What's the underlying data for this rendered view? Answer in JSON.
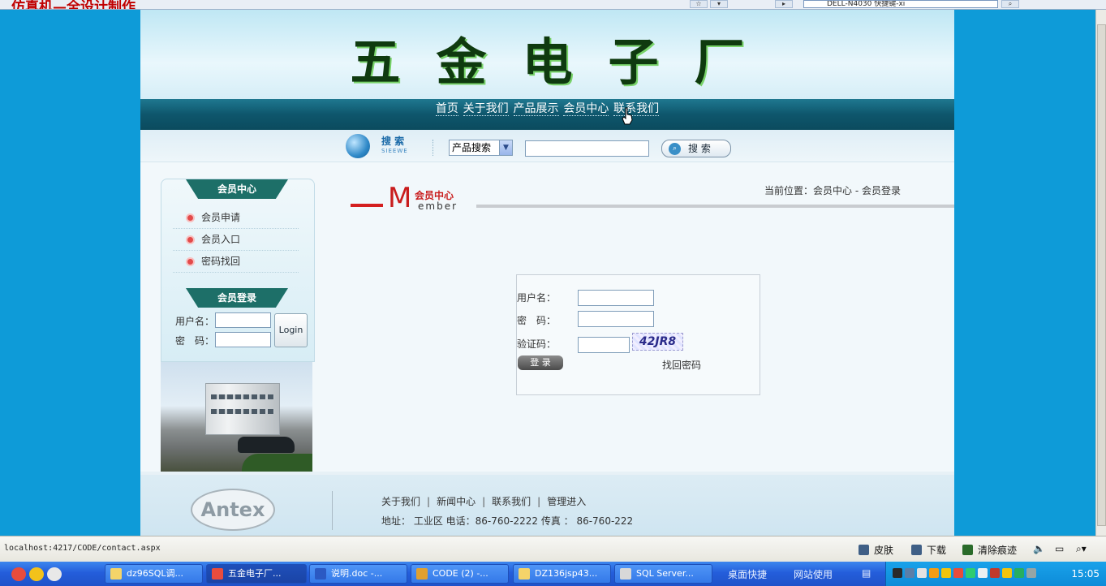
{
  "browser": {
    "ghost_title": "仿真机—全设计制作",
    "address_snippet": "DELL-N4030 快捷键-xi"
  },
  "site": {
    "title": "五金电子厂",
    "nav": [
      "首页",
      "关于我们",
      "产品展示",
      "会员中心",
      "联系我们"
    ],
    "search": {
      "label_cn": "搜 索",
      "label_en": "SIEEWE",
      "category": "产品搜索",
      "button": "搜 索"
    }
  },
  "sidebar": {
    "member_center_title": "会员中心",
    "items": [
      "会员申请",
      "会员入口",
      "密码找回"
    ],
    "login_title": "会员登录",
    "username_label": "用户名：",
    "password_label": "密　码：",
    "login_button": "Login"
  },
  "content": {
    "logo_M": "M",
    "logo_cn": "会员中心",
    "logo_en": "ember",
    "breadcrumb": "当前位置：会员中心 - 会员登录",
    "form": {
      "username_label": "用户名：",
      "password_label": "密　码：",
      "captcha_label": "验证码：",
      "captcha_text": "42JR8",
      "submit_label": "登 录",
      "forgot_label": "找回密码"
    }
  },
  "footer": {
    "logo_text": "Antex",
    "links": [
      "关于我们",
      "新闻中心",
      "联系我们",
      "管理进入"
    ],
    "address": "地址： 工业区  电话：86-760-2222 传真 ：  86-760-222"
  },
  "statusbar": {
    "url": "localhost:4217/CODE/contact.aspx",
    "skin": "皮肤",
    "download": "下载",
    "clear": "清除痕迹"
  },
  "taskbar": {
    "buttons": [
      "dz96SQL调...",
      "五金电子厂...",
      "说明.doc -...",
      "CODE (2) -...",
      "DZ136jsp43...",
      "SQL Server..."
    ],
    "quick1": "桌面快捷",
    "quick2": "网站使用",
    "clock": "15:05"
  }
}
